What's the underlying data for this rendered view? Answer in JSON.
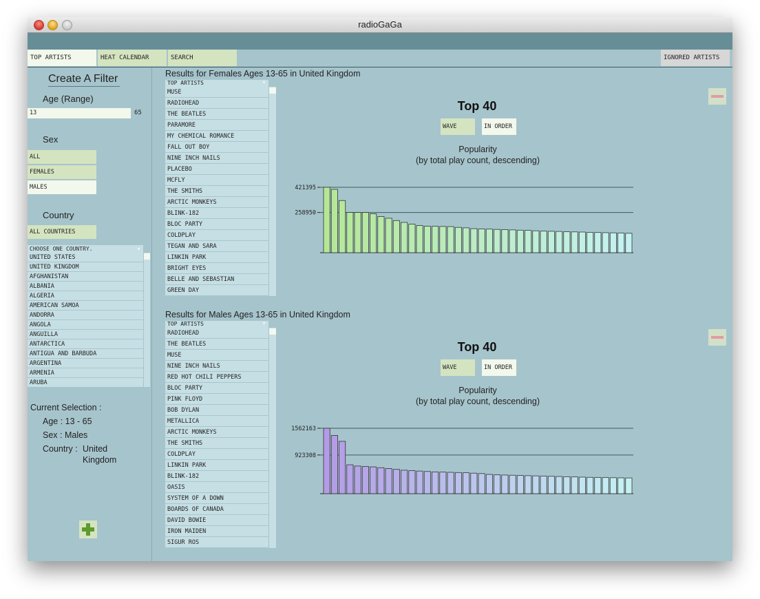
{
  "window": {
    "title": "radioGaGa"
  },
  "tabs": [
    {
      "label": "TOP ARTISTS",
      "active": true
    },
    {
      "label": "HEAT CALENDAR",
      "active": false
    },
    {
      "label": "SEARCH",
      "active": false
    },
    {
      "label": "IGNORED ARTISTS",
      "active": false
    }
  ],
  "filter": {
    "heading": "Create A Filter",
    "age_label": "Age (Range)",
    "age_min": "13",
    "age_max": "65",
    "sex_label": "Sex",
    "sex_options": [
      "ALL",
      "FEMALES",
      "MALES"
    ],
    "sex_selected": "MALES",
    "country_label": "Country",
    "all_countries": "ALL COUNTRIES",
    "country_dropdown": "CHOOSE ONE COUNTRY.",
    "countries": [
      "UNITED STATES",
      "UNITED KINGDOM",
      "AFGHANISTAN",
      "ALBANIA",
      "ALGERIA",
      "AMERICAN SAMOA",
      "ANDORRA",
      "ANGOLA",
      "ANGUILLA",
      "ANTARCTICA",
      "ANTIGUA AND BARBUDA",
      "ARGENTINA",
      "ARMENIA",
      "ARUBA"
    ],
    "current_selection": {
      "heading": "Current Selection :",
      "age": "Age : 13 - 65",
      "sex": "Sex : Males",
      "country_label": "Country :",
      "country_line1": "United",
      "country_line2": "Kingdom"
    }
  },
  "panels": [
    {
      "title": "Results for Females Ages 13-65 in United Kingdom",
      "dropdown": "TOP ARTISTS",
      "artists": [
        "MUSE",
        "RADIOHEAD",
        "THE BEATLES",
        "PARAMORE",
        "MY CHEMICAL ROMANCE",
        "FALL OUT BOY",
        "NINE INCH NAILS",
        "PLACEBO",
        "MCFLY",
        "THE SMITHS",
        "ARCTIC MONKEYS",
        "BLINK-182",
        "BLOC PARTY",
        "COLDPLAY",
        "TEGAN AND SARA",
        "LINKIN PARK",
        "BRIGHT EYES",
        "BELLE AND SEBASTIAN",
        "GREEN DAY"
      ],
      "chart_title": "Top 40",
      "mode_buttons": [
        "WAVE",
        "IN ORDER"
      ],
      "pop_line1": "Popularity",
      "pop_line2": "(by total play count, descending)"
    },
    {
      "title": "Results for Males Ages 13-65 in United Kingdom",
      "dropdown": "TOP ARTISTS",
      "artists": [
        "RADIOHEAD",
        "THE BEATLES",
        "MUSE",
        "NINE INCH NAILS",
        "RED HOT CHILI PEPPERS",
        "BLOC PARTY",
        "PINK FLOYD",
        "BOB DYLAN",
        "METALLICA",
        "ARCTIC MONKEYS",
        "THE SMITHS",
        "COLDPLAY",
        "LINKIN PARK",
        "BLINK-182",
        "OASIS",
        "SYSTEM OF A DOWN",
        "BOARDS OF CANADA",
        "DAVID BOWIE",
        "IRON MAIDEN",
        "SIGUR ROS"
      ],
      "chart_title": "Top 40",
      "mode_buttons": [
        "WAVE",
        "IN ORDER"
      ],
      "pop_line1": "Popularity",
      "pop_line2": "(by total play count, descending)"
    }
  ],
  "chart_data": [
    {
      "type": "bar",
      "title": "Top 40",
      "subtitle": "Popularity (by total play count, descending)",
      "y_ticks": [
        421395,
        258950
      ],
      "ylim": [
        0,
        421395
      ],
      "colors": {
        "start": "#b4e796",
        "end": "#c4f2f2"
      },
      "values": [
        421395,
        408000,
        336000,
        259000,
        259000,
        258950,
        251000,
        233000,
        222000,
        207000,
        195000,
        184000,
        175000,
        171000,
        170000,
        169000,
        168000,
        163000,
        160000,
        155000,
        153000,
        152000,
        150000,
        149000,
        147000,
        145000,
        144000,
        141000,
        139000,
        138000,
        137000,
        135000,
        134000,
        133000,
        131000,
        130000,
        129000,
        128000,
        127000,
        125000
      ]
    },
    {
      "type": "bar",
      "title": "Top 40",
      "subtitle": "Popularity (by total play count, descending)",
      "y_ticks": [
        1562163,
        923308
      ],
      "ylim": [
        0,
        1562163
      ],
      "colors": {
        "start": "#b49be7",
        "end": "#c4f2f2"
      },
      "values": [
        1562163,
        1390000,
        1250000,
        690000,
        660000,
        650000,
        640000,
        620000,
        600000,
        580000,
        560000,
        550000,
        540000,
        530000,
        520000,
        515000,
        510000,
        505000,
        500000,
        490000,
        480000,
        460000,
        450000,
        445000,
        440000,
        435000,
        430000,
        425000,
        420000,
        415000,
        410000,
        405000,
        400000,
        395000,
        390000,
        387000,
        384000,
        381000,
        378000,
        375000
      ]
    }
  ]
}
